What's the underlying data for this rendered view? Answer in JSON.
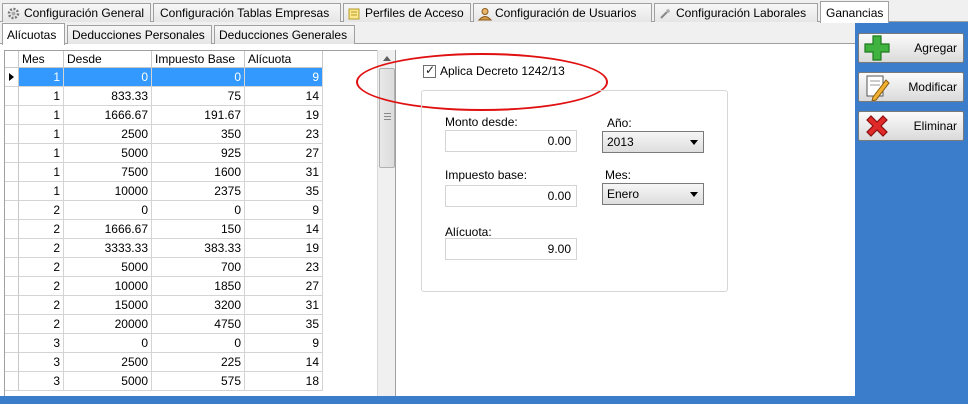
{
  "top_tabs": [
    {
      "label": "Configuración General"
    },
    {
      "label": "Configuración Tablas Empresas"
    },
    {
      "label": "Perfiles de Acceso"
    },
    {
      "label": "Configuración de Usuarios"
    },
    {
      "label": "Configuración Laborales"
    },
    {
      "label": "Ganancias",
      "active": true
    }
  ],
  "inner_tabs": [
    {
      "label": "Alícuotas",
      "active": true
    },
    {
      "label": "Deducciones Personales"
    },
    {
      "label": "Deducciones Generales"
    }
  ],
  "grid": {
    "columns": [
      "Mes",
      "Desde",
      "Impuesto Base",
      "Alícuota"
    ],
    "rows": [
      [
        "1",
        "0",
        "0",
        "9"
      ],
      [
        "1",
        "833.33",
        "75",
        "14"
      ],
      [
        "1",
        "1666.67",
        "191.67",
        "19"
      ],
      [
        "1",
        "2500",
        "350",
        "23"
      ],
      [
        "1",
        "5000",
        "925",
        "27"
      ],
      [
        "1",
        "7500",
        "1600",
        "31"
      ],
      [
        "1",
        "10000",
        "2375",
        "35"
      ],
      [
        "2",
        "0",
        "0",
        "9"
      ],
      [
        "2",
        "1666.67",
        "150",
        "14"
      ],
      [
        "2",
        "3333.33",
        "383.33",
        "19"
      ],
      [
        "2",
        "5000",
        "700",
        "23"
      ],
      [
        "2",
        "10000",
        "1850",
        "27"
      ],
      [
        "2",
        "15000",
        "3200",
        "31"
      ],
      [
        "2",
        "20000",
        "4750",
        "35"
      ],
      [
        "3",
        "0",
        "0",
        "9"
      ],
      [
        "3",
        "2500",
        "225",
        "14"
      ],
      [
        "3",
        "5000",
        "575",
        "18"
      ]
    ],
    "selected_row": 0
  },
  "form": {
    "aplica_label": "Aplica Decreto 1242/13",
    "aplica_checked": true,
    "monto_desde_label": "Monto desde:",
    "monto_desde_value": "0.00",
    "impuesto_base_label": "Impuesto base:",
    "impuesto_base_value": "0.00",
    "alicuota_label": "Alícuota:",
    "alicuota_value": "9.00",
    "anio_label": "Año:",
    "anio_value": "2013",
    "mes_label": "Mes:",
    "mes_value": "Enero"
  },
  "actions": {
    "agregar": "Agregar",
    "modificar": "Modificar",
    "eliminar": "Eliminar"
  },
  "colors": {
    "selection": "#3399ff",
    "side_panel": "#3b7ccb",
    "highlight_ellipse": "#e01010"
  }
}
